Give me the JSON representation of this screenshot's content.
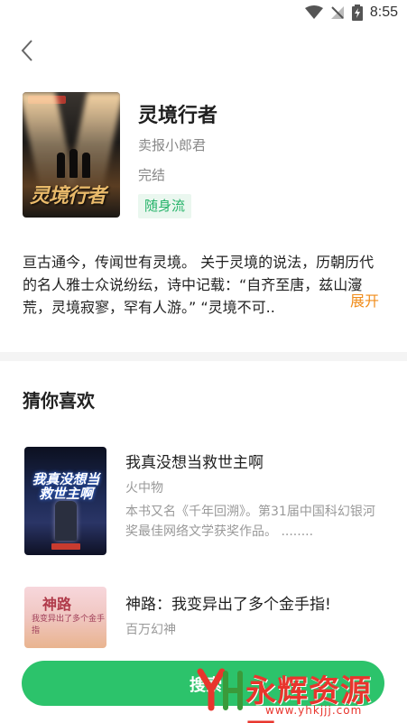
{
  "status_bar": {
    "time": "8:55"
  },
  "book": {
    "title": "灵境行者",
    "author": "卖报小郎君",
    "status": "完结",
    "tag": "随身流",
    "description": "亘古通今，传闻世有灵境。 关于灵境的说法，历朝历代的名人雅士众说纷纭，诗中记载：“自齐至唐，兹山濅荒，灵境寂寥，罕有人游。” “灵境不可..",
    "expand_label": "展开",
    "cover_title": "灵境行者"
  },
  "recommend": {
    "section_title": "猜你喜欢",
    "items": [
      {
        "title": "我真没想当救世主啊",
        "author": "火中物",
        "description": "本书又名《千年回溯》。第31届中国科幻银河奖最佳网络文学获奖作品。 ........",
        "cover_title": "我真没想当救世主啊"
      },
      {
        "title": "神路：我变异出了多个金手指!",
        "author": "百万幻神",
        "description": "",
        "cover_title": "神路",
        "cover_subtitle": "我变异出了多个金手指"
      }
    ]
  },
  "bottom": {
    "search_label": "搜索"
  },
  "watermark": {
    "text": "永辉资源网",
    "url": "www.yhkjjj.com"
  },
  "colors": {
    "accent_green": "#2cc36b",
    "expand_orange": "#f08c1a",
    "tag_green": "#27b36a"
  }
}
